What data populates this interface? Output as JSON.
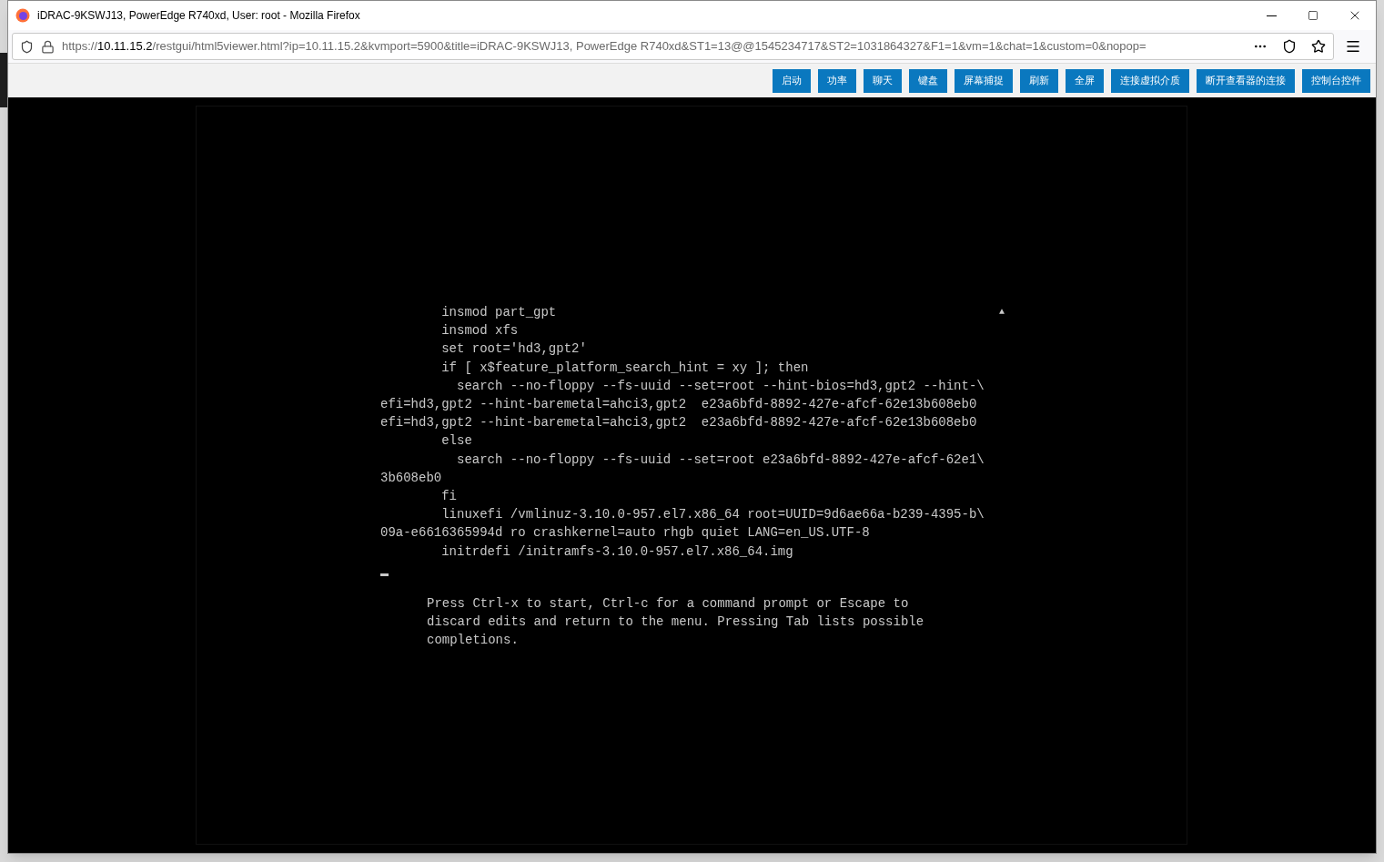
{
  "window": {
    "title": "iDRAC-9KSWJ13, PowerEdge R740xd, User: root - Mozilla Firefox"
  },
  "address_bar": {
    "scheme": "https://",
    "host": "10.11.15.2",
    "path": "/restgui/html5viewer.html?ip=10.11.15.2&kvmport=5900&title=iDRAC-9KSWJ13, PowerEdge R740xd&ST1=13@@1545234717&ST2=1031864327&F1=1&vm=1&chat=1&custom=0&nopop="
  },
  "toolbar_buttons": [
    "启动",
    "功率",
    "聊天",
    "键盘",
    "屏幕捕捉",
    "刷新",
    "全屏",
    "连接虚拟介质",
    "断开查看器的连接",
    "控制台控件"
  ],
  "console": {
    "scroll_marker": "▲",
    "lines": [
      "        insmod part_gpt",
      "        insmod xfs",
      "        set root='hd3,gpt2'",
      "        if [ x$feature_platform_search_hint = xy ]; then",
      "          search --no-floppy --fs-uuid --set=root --hint-bios=hd3,gpt2 --hint-\\",
      "efi=hd3,gpt2 --hint-baremetal=ahci3,gpt2  e23a6bfd-8892-427e-afcf-62e13b608eb0",
      "efi=hd3,gpt2 --hint-baremetal=ahci3,gpt2  e23a6bfd-8892-427e-afcf-62e13b608eb0",
      "        else",
      "          search --no-floppy --fs-uuid --set=root e23a6bfd-8892-427e-afcf-62e1\\",
      "3b608eb0",
      "        fi",
      "        linuxefi /vmlinuz-3.10.0-957.el7.x86_64 root=UUID=9d6ae66a-b239-4395-b\\",
      "09a-e6616365994d ro crashkernel=auto rhgb quiet LANG=en_US.UTF-8",
      "        initrdefi /initramfs-3.10.0-957.el7.x86_64.img"
    ],
    "help": [
      "Press Ctrl-x to start, Ctrl-c for a command prompt or Escape to",
      "discard edits and return to the menu. Pressing Tab lists possible",
      "completions."
    ]
  }
}
